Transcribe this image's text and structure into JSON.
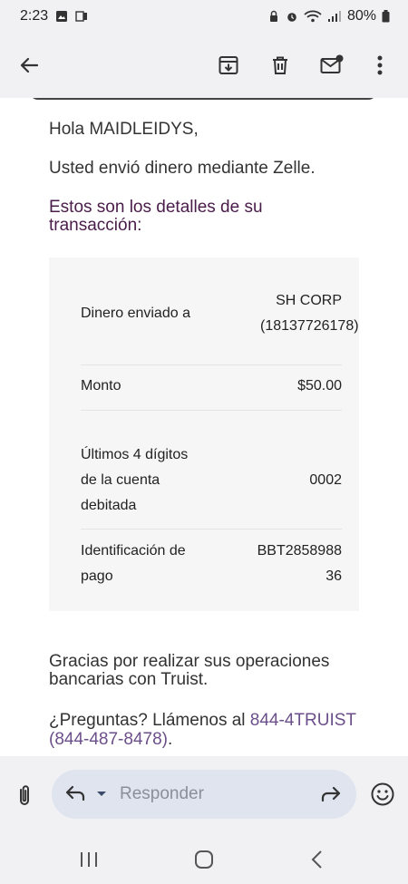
{
  "status_bar": {
    "time": "2:23",
    "battery": "80%"
  },
  "app_bar": {
    "back_icon": "arrow-left-icon",
    "archive_icon": "archive-icon",
    "delete_icon": "trash-icon",
    "mark_unread_icon": "mail-unread-icon",
    "more_icon": "more-vert-icon"
  },
  "email": {
    "greeting": "Hola MAIDLEIDYS,",
    "sent_line": "Usted envió dinero mediante Zelle.",
    "details_title": "Estos son los detalles de su transacción:",
    "rows": [
      {
        "label": "Dinero enviado a",
        "value": "SH CORP (18137726178)"
      },
      {
        "label": "Monto",
        "value": "$50.00"
      },
      {
        "label": "Últimos 4 dígitos de la cuenta debitada",
        "value": "0002"
      },
      {
        "label": "Identificación de pago",
        "value": "BBT285898836"
      }
    ],
    "thanks": "Gracias por realizar sus operaciones bancarias con Truist.",
    "questions_prefix": "¿Preguntas? Llámenos al ",
    "questions_phone": "844-4TRUIST (844-487-8478)",
    "questions_suffix": "."
  },
  "reply_bar": {
    "placeholder": "Responder"
  },
  "colors": {
    "title_purple": "#4a1c4a",
    "link_purple": "#6b4f8a",
    "pill": "#dfe4ef"
  }
}
